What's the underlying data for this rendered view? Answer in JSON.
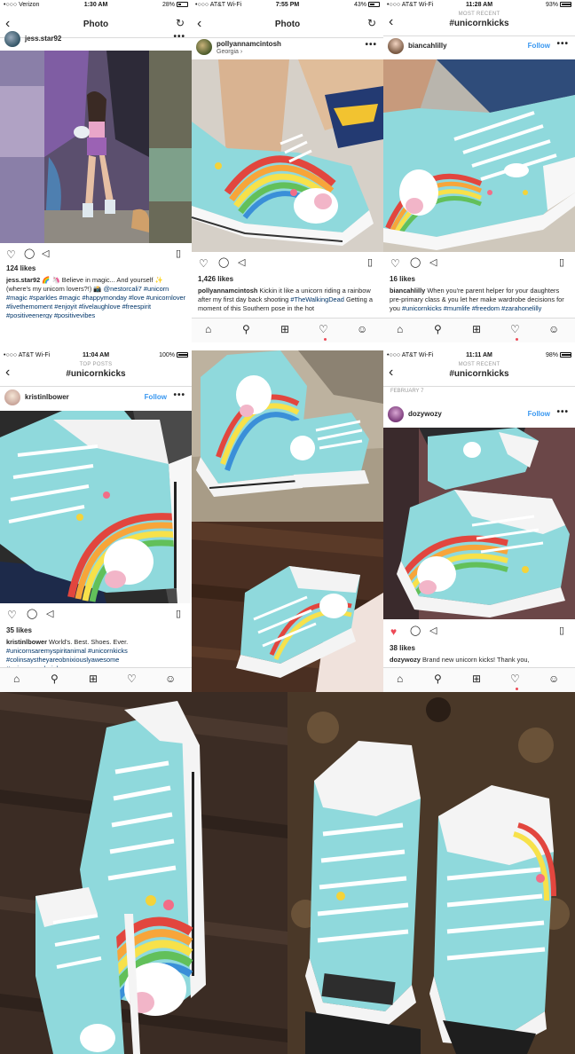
{
  "p1": {
    "status": {
      "carrier": "•○○○ Verizon",
      "time": "1:30 AM",
      "battery": "28%"
    },
    "nav": {
      "title": "Photo",
      "back": "‹",
      "refresh": "↻"
    },
    "user": {
      "name": "jess.star92"
    },
    "likes": "124 likes",
    "caption": {
      "user": "jess.star92",
      "text": " 🌈 🦄 Believe in magic... And yourself ✨ (where's my unicorn lovers?!) 📸 ",
      "mention": "@nestorcali7",
      "hashtags": "#unicorn #magic #sparkles #magic #happymonday #love #unicornlover #livethemoment #enjoyit #livelaughlove #freespirit #positiveenergy #positivevibes"
    }
  },
  "p2": {
    "status": {
      "carrier": "•○○○ AT&T Wi-Fi",
      "time": "7:55 PM",
      "battery": "43%"
    },
    "nav": {
      "title": "Photo",
      "back": "‹",
      "refresh": "↻"
    },
    "user": {
      "name": "pollyannamcintosh",
      "location": "Georgia ›"
    },
    "likes": "1,426 likes",
    "caption": {
      "user": "pollyannamcintosh",
      "text": " Kickin it like a unicorn riding a rainbow after my first day back shooting ",
      "hashtags": "#TheWalkingDead",
      "more": "Getting a moment of this Southern pose in the hot"
    }
  },
  "p3": {
    "status": {
      "carrier": "•○○○ AT&T Wi-Fi",
      "time": "11:28 AM",
      "battery": "93%"
    },
    "nav": {
      "sub": "MOST RECENT",
      "tag": "#unicornkicks",
      "back": "‹"
    },
    "user": {
      "name": "biancahlilly",
      "follow": "Follow"
    },
    "likes": "16 likes",
    "caption": {
      "user": "biancahlilly",
      "text": " When you're parent helper for your daughters pre-primary class & you let her make wardrobe decisions for you ",
      "hashtags": "#unicornkicks #mumlife #freedom #zarahonelilly"
    }
  },
  "p4": {
    "status": {
      "carrier": "•○○○ AT&T Wi-Fi",
      "time": "11:04 AM",
      "battery": "100%"
    },
    "nav": {
      "sub": "TOP POSTS",
      "tag": "#unicornkicks",
      "back": "‹"
    },
    "user": {
      "name": "kristinlbower",
      "follow": "Follow"
    },
    "likes": "35 likes",
    "caption": {
      "user": "kristinlbower",
      "text": " World's. Best. Shoes. Ever. ",
      "hashtags": "#unicornsaremyspiritanimal #unicornkicks #colinsaystheyareobnixiouslyawesome #unicornsandrainbows"
    }
  },
  "p6": {
    "status": {
      "carrier": "•○○○ AT&T Wi-Fi",
      "time": "11:11 AM",
      "battery": "98%"
    },
    "nav": {
      "sub": "MOST RECENT",
      "tag": "#unicornkicks",
      "back": "‹"
    },
    "date": "FEBRUARY 7",
    "user": {
      "name": "dozywozy",
      "follow": "Follow"
    },
    "likes": "38 likes",
    "caption": {
      "user": "dozywozy",
      "text": " Brand new unicorn kicks! Thank you,"
    }
  },
  "icons": {
    "more": "•••",
    "heart": "♡",
    "heart_filled": "♥",
    "comment": "◯",
    "share": "◁",
    "bookmark": "▯",
    "home": "⌂",
    "search": "⚲",
    "add": "⊞",
    "activity": "♡",
    "profile": "☺"
  },
  "colors": {
    "link": "#3897f0",
    "hashtag": "#003569",
    "like_red": "#ed4956",
    "shoe_teal": "#8fd9dc"
  }
}
